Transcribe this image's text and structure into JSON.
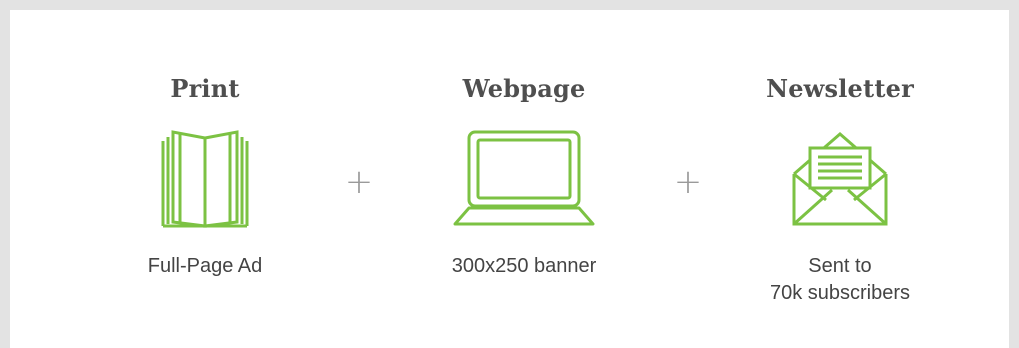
{
  "colors": {
    "accent": "#7cc243",
    "frame": "#e3e3e3",
    "title_text": "#4f4f4f",
    "caption_text": "#444444",
    "plus_sign": "#9a9a9a"
  },
  "channels": [
    {
      "title": "Print",
      "icon": "open-book-icon",
      "caption_line1": "Full-Page Ad",
      "caption_line2": ""
    },
    {
      "title": "Webpage",
      "icon": "laptop-icon",
      "caption_line1": "300x250 banner",
      "caption_line2": ""
    },
    {
      "title": "Newsletter",
      "icon": "open-envelope-letter-icon",
      "caption_line1": "Sent to",
      "caption_line2": "70k subscribers"
    }
  ],
  "separators": [
    "+",
    "+"
  ]
}
